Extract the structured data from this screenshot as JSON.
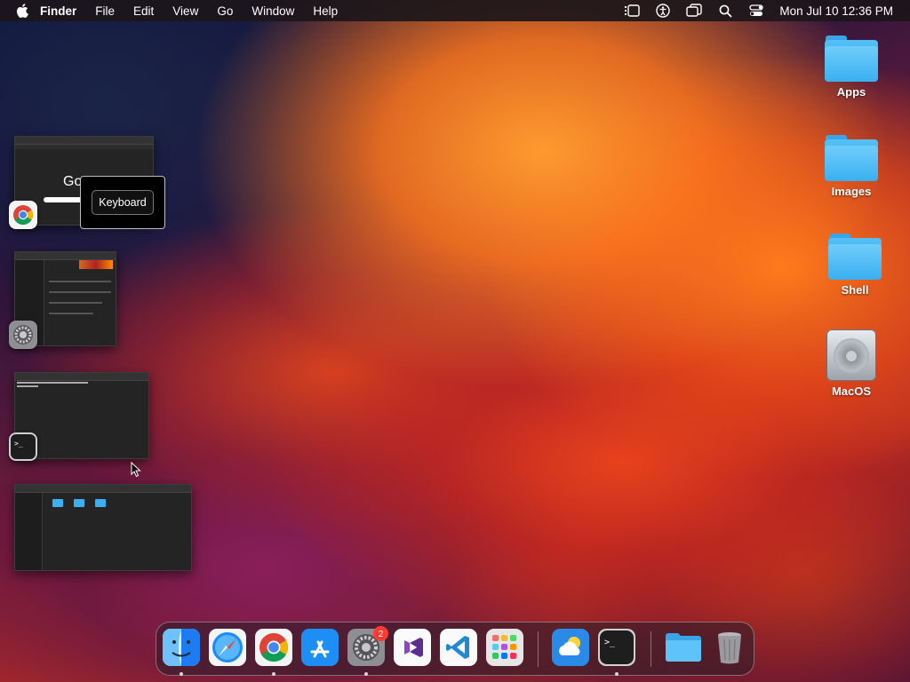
{
  "menubar": {
    "app_name": "Finder",
    "menus": [
      "File",
      "Edit",
      "View",
      "Go",
      "Window",
      "Help"
    ],
    "clock": "Mon Jul 10  12:36 PM"
  },
  "desktop": {
    "icons": [
      {
        "label": "Apps",
        "kind": "folder-icon"
      },
      {
        "label": "Images",
        "kind": "folder-icon"
      },
      {
        "label": "Shell",
        "kind": "folder-icon"
      },
      {
        "label": "MacOS",
        "kind": "hard-drive-icon"
      }
    ]
  },
  "stage_manager": {
    "tooltip": "Keyboard",
    "thumbnails": [
      {
        "app": "Google Chrome",
        "icon": "chrome-icon",
        "preview_text": "Go"
      },
      {
        "app": "System Settings",
        "icon": "system-settings-icon"
      },
      {
        "app": "Terminal",
        "icon": "terminal-icon"
      },
      {
        "app": "Finder",
        "icon": "finder-icon"
      }
    ]
  },
  "dock": {
    "items": [
      {
        "name": "Finder",
        "icon": "finder-icon",
        "running": true
      },
      {
        "name": "Safari",
        "icon": "safari-icon",
        "running": false
      },
      {
        "name": "Google Chrome",
        "icon": "chrome-icon",
        "running": true
      },
      {
        "name": "App Store",
        "icon": "app-store-icon",
        "running": false
      },
      {
        "name": "System Settings",
        "icon": "system-settings-icon",
        "running": true,
        "badge": "2"
      },
      {
        "name": "Visual Studio",
        "icon": "visual-studio-icon",
        "running": false
      },
      {
        "name": "Visual Studio Code",
        "icon": "vscode-icon",
        "running": false
      },
      {
        "name": "Launchpad",
        "icon": "launchpad-icon",
        "running": false
      },
      {
        "name": "Weather",
        "icon": "weather-icon",
        "running": false
      },
      {
        "name": "Terminal",
        "icon": "terminal-icon",
        "running": true
      },
      {
        "name": "Downloads",
        "icon": "folder-icon",
        "running": false
      },
      {
        "name": "Trash",
        "icon": "trash-icon",
        "running": false
      }
    ]
  },
  "colors": {
    "menubar_bg": "#1c161a",
    "folder_blue": "#3ab0f0",
    "badge_red": "#ff3b30"
  }
}
